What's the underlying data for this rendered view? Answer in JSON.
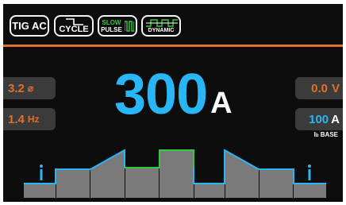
{
  "modes": {
    "tig_ac": "TIG AC",
    "cycle": "CYCLE",
    "pulse_slow": "SLOW",
    "pulse": "PULSE",
    "dynamic": "DYNAMIC"
  },
  "left": {
    "diameter_value": "3.2",
    "diameter_unit": "⌀",
    "frequency_value": "1.4",
    "frequency_unit": "Hz"
  },
  "main": {
    "current_value": "300",
    "current_unit": "A"
  },
  "right": {
    "voltage_value": "0.0",
    "voltage_unit": "V",
    "base_value": "100",
    "base_unit": "A",
    "base_label": "I",
    "base_label_sub": "b",
    "base_label_text": "BASE"
  },
  "colors": {
    "accent_orange": "#e0712a",
    "value_blue": "#29b6f6",
    "active_green": "#2ecc40",
    "panel_grey": "#3b3b3b",
    "background": "#0d0d0d"
  }
}
